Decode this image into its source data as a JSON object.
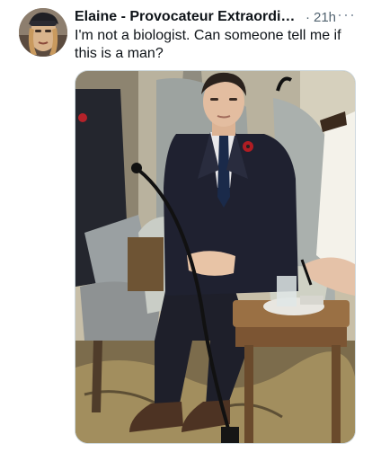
{
  "tweet": {
    "author_name": "Elaine - Provocateur Extraordin...",
    "separator": "·",
    "timestamp": "21h",
    "more_label": "···",
    "text": "I'm not a biologist.  Can someone tell me if this is a man?"
  },
  "icons": {
    "avatar": "profile-photo",
    "more": "more-options-icon",
    "media": "photo-man-in-suit-seated"
  },
  "colors": {
    "name": "#0f1419",
    "meta": "#536471",
    "border": "#cfd9de"
  }
}
